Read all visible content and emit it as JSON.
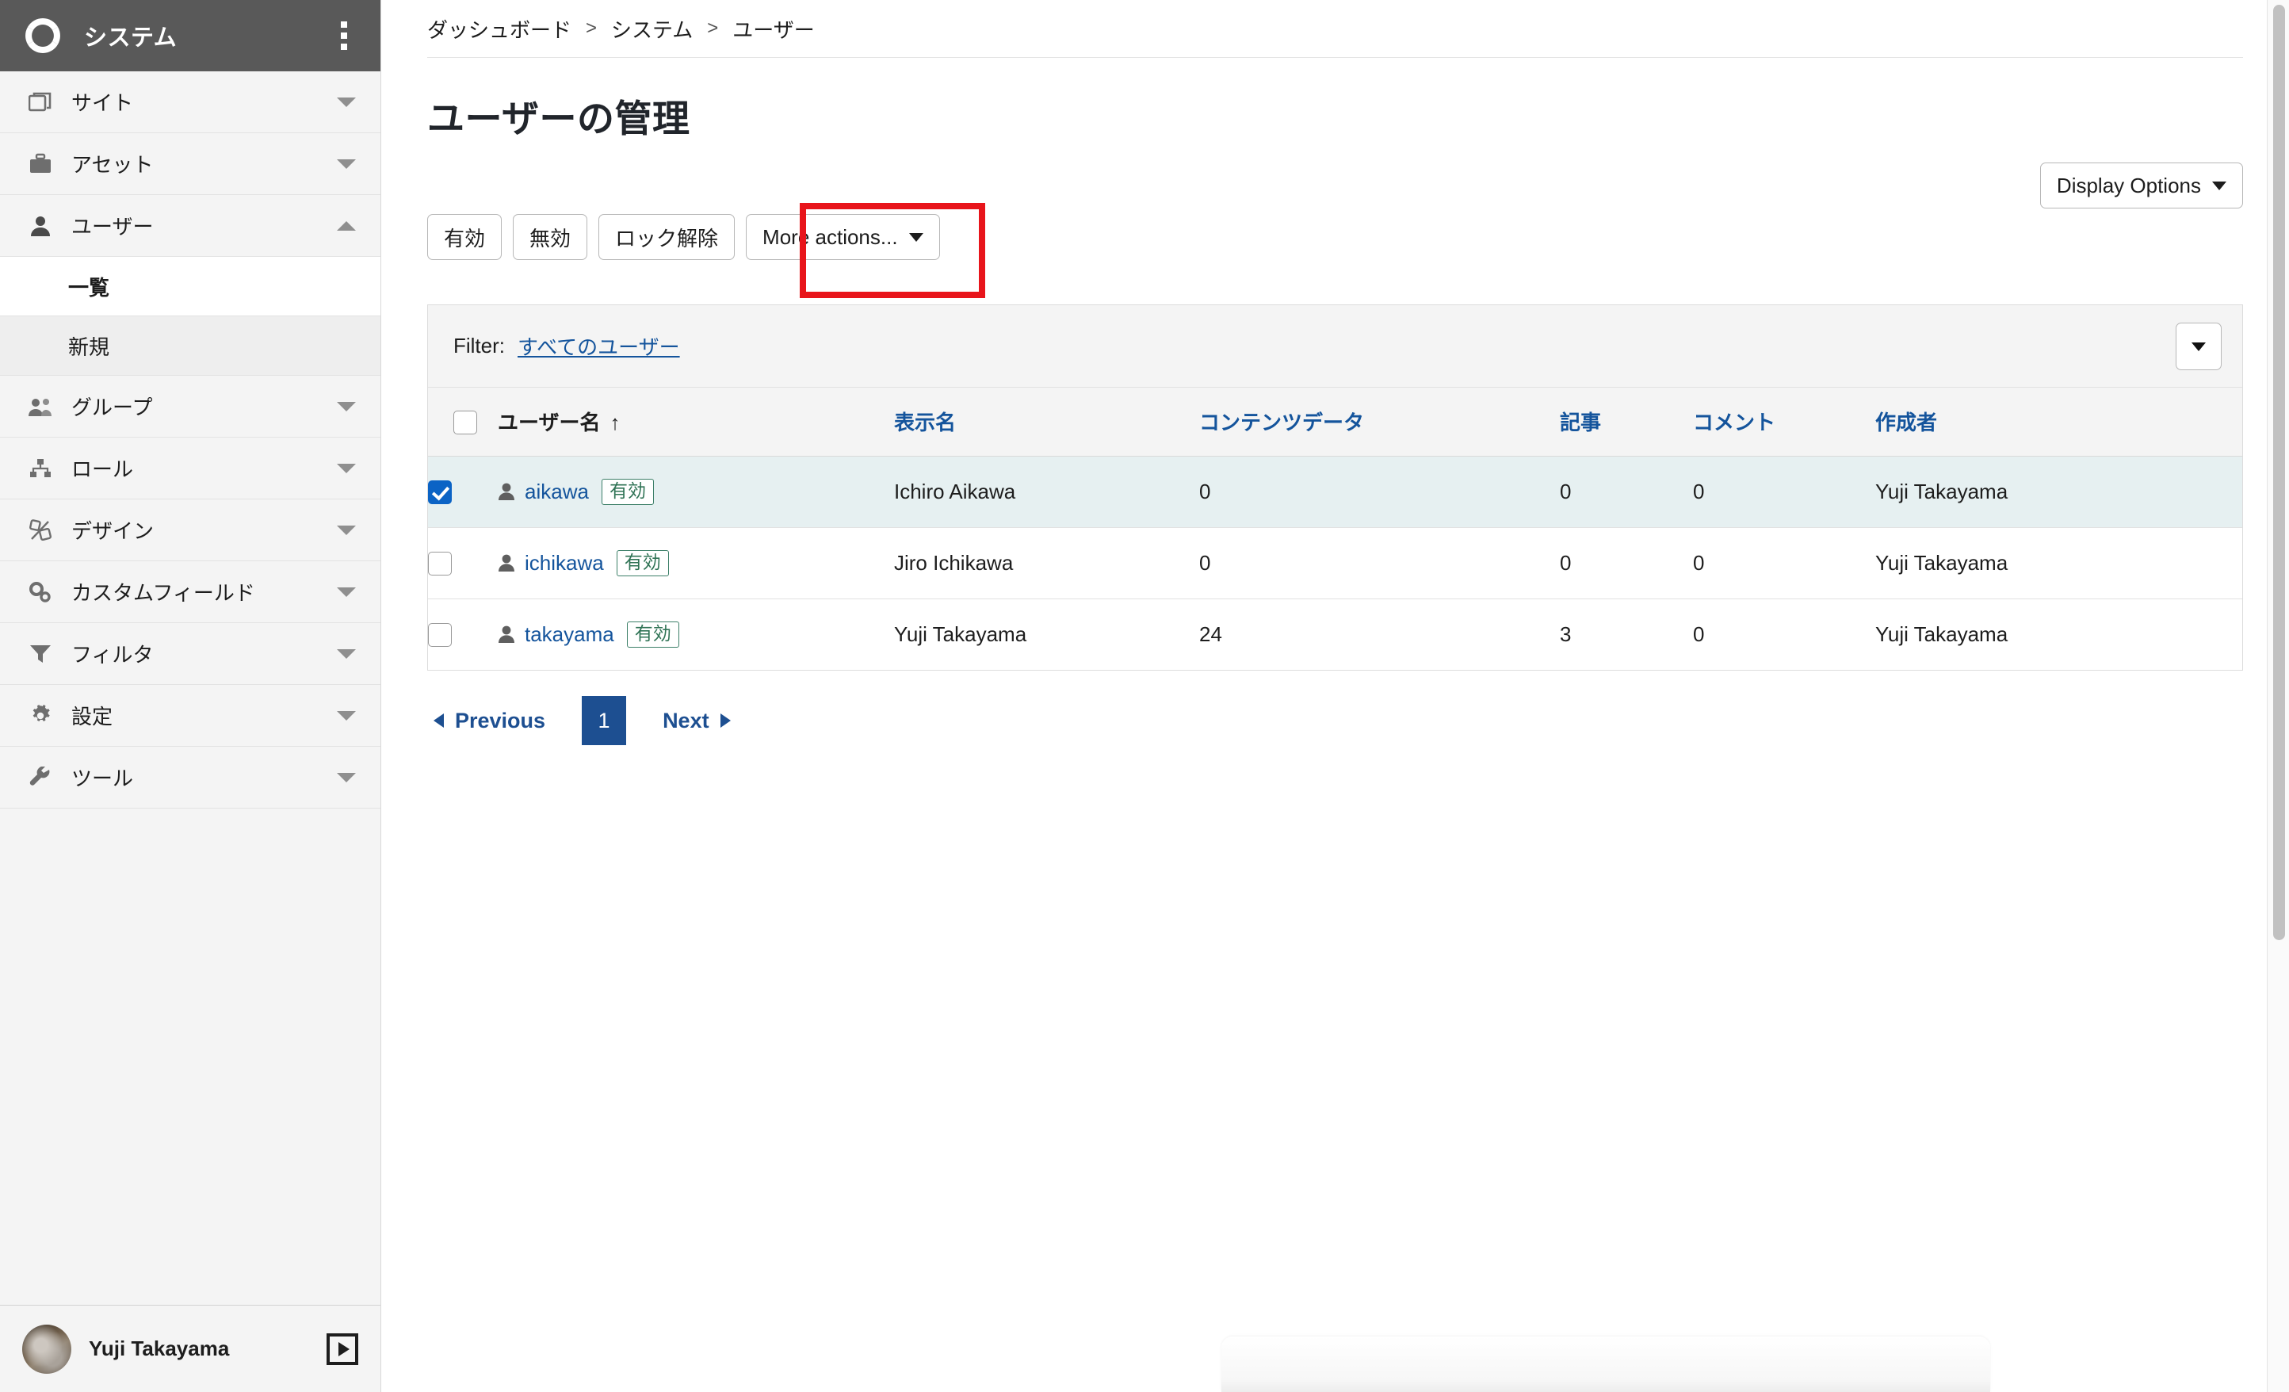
{
  "sidebar": {
    "brand": "システム",
    "logo_icon": "ring-logo-icon",
    "kebab_icon": "more-vertical-icon",
    "items": [
      {
        "label": "サイト",
        "icon": "window-icon",
        "caret": "chevron-down-icon",
        "expanded": false
      },
      {
        "label": "アセット",
        "icon": "briefcase-icon",
        "caret": "chevron-down-icon",
        "expanded": false
      },
      {
        "label": "ユーザー",
        "icon": "user-icon",
        "caret": "chevron-up-icon",
        "expanded": true
      },
      {
        "label": "グループ",
        "icon": "users-icon",
        "caret": "chevron-down-icon",
        "expanded": false
      },
      {
        "label": "ロール",
        "icon": "sitemap-icon",
        "caret": "chevron-down-icon",
        "expanded": false
      },
      {
        "label": "デザイン",
        "icon": "design-icon",
        "caret": "chevron-down-icon",
        "expanded": false
      },
      {
        "label": "カスタムフィールド",
        "icon": "gears-icon",
        "caret": "chevron-down-icon",
        "expanded": false
      },
      {
        "label": "フィルタ",
        "icon": "funnel-icon",
        "caret": "chevron-down-icon",
        "expanded": false
      },
      {
        "label": "設定",
        "icon": "gear-icon",
        "caret": "chevron-down-icon",
        "expanded": false
      },
      {
        "label": "ツール",
        "icon": "wrench-icon",
        "caret": "chevron-down-icon",
        "expanded": false
      }
    ],
    "sub_items": [
      {
        "label": "一覧",
        "active": true
      },
      {
        "label": "新規",
        "active": false
      }
    ],
    "footer": {
      "user_name": "Yuji Takayama",
      "avatar_icon": "user-avatar",
      "collapse_icon": "collapse-panel-icon"
    }
  },
  "breadcrumb": {
    "items": [
      "ダッシュボード",
      "システム",
      "ユーザー"
    ],
    "separator": ">"
  },
  "page": {
    "title": "ユーザーの管理"
  },
  "display_options": {
    "label": "Display Options",
    "caret_icon": "caret-down-icon"
  },
  "toolbar": {
    "buttons": [
      {
        "label": "有効",
        "highlighted": true
      },
      {
        "label": "無効",
        "highlighted": true
      },
      {
        "label": "ロック解除",
        "highlighted": false
      },
      {
        "label": "More actions...",
        "highlighted": false,
        "caret_icon": "caret-down-icon"
      }
    ]
  },
  "filter": {
    "label": "Filter:",
    "value": "すべてのユーザー",
    "toggle_icon": "caret-down-icon"
  },
  "table": {
    "columns": [
      {
        "key": "check",
        "label": "",
        "sorted": false,
        "link": false
      },
      {
        "key": "user",
        "label": "ユーザー名",
        "sorted": true,
        "sort_dir": "↑",
        "link": false
      },
      {
        "key": "disp",
        "label": "表示名",
        "sorted": false,
        "link": true
      },
      {
        "key": "data",
        "label": "コンテンツデータ",
        "sorted": false,
        "link": true
      },
      {
        "key": "art",
        "label": "記事",
        "sorted": false,
        "link": true
      },
      {
        "key": "com",
        "label": "コメント",
        "sorted": false,
        "link": true
      },
      {
        "key": "auth",
        "label": "作成者",
        "sorted": false,
        "link": true
      }
    ],
    "select_all_checked": false,
    "rows": [
      {
        "checked": true,
        "username": "aikawa",
        "status": "有効",
        "display_name": "Ichiro Aikawa",
        "content_data": "0",
        "articles": "0",
        "comments": "0",
        "author": "Yuji Takayama"
      },
      {
        "checked": false,
        "username": "ichikawa",
        "status": "有効",
        "display_name": "Jiro Ichikawa",
        "content_data": "0",
        "articles": "0",
        "comments": "0",
        "author": "Yuji Takayama"
      },
      {
        "checked": false,
        "username": "takayama",
        "status": "有効",
        "display_name": "Yuji Takayama",
        "content_data": "24",
        "articles": "3",
        "comments": "0",
        "author": "Yuji Takayama"
      }
    ]
  },
  "pagination": {
    "previous": "Previous",
    "current_page": "1",
    "next": "Next"
  },
  "colors": {
    "sidebar_header": "#595959",
    "sidebar_bg": "#f4f4f4",
    "link_blue": "#14549c",
    "pager_blue": "#1d4f91",
    "selected_row": "#e6f0f1",
    "badge_green": "#2f7355",
    "highlight_red": "#e8151b",
    "checkbox_blue": "#0b63c5"
  }
}
